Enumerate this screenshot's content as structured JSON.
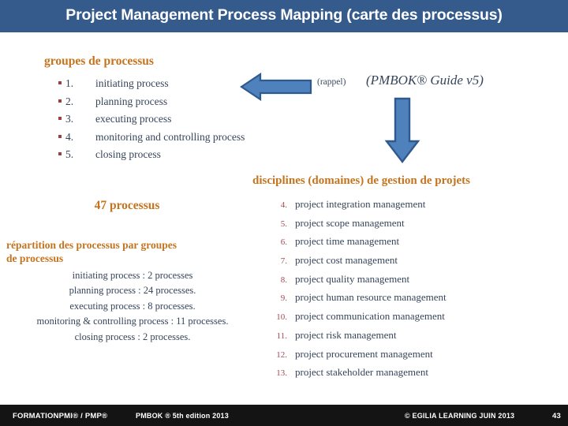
{
  "slide": {
    "title": "Project Management Process Mapping  (carte des processus)",
    "page_number": "43",
    "accent_color": "#c4741e",
    "banner_color": "#355b8c",
    "arrow_fill": "#4f81bd",
    "arrow_stroke": "#2e5a8e",
    "body_text_color": "#36455a",
    "number_color": "#a14a55",
    "footer_color": "#141414"
  },
  "process_groups": {
    "heading": "groupes de processus",
    "items": [
      {
        "num": "1.",
        "label": "initiating process"
      },
      {
        "num": "2.",
        "label": "planning process"
      },
      {
        "num": "3.",
        "label": "executing process"
      },
      {
        "num": "4.",
        "label": "monitoring and controlling process"
      },
      {
        "num": "5.",
        "label": "closing process"
      }
    ]
  },
  "annotation": {
    "rappel": "(rappel)",
    "pmbok_guide": "(PMBOK® Guide v5)",
    "left_arrow_icon": "arrow-left-icon",
    "down_arrow_icon": "arrow-down-icon"
  },
  "knowledge_areas": {
    "heading": "disciplines (domaines) de gestion de projets",
    "items": [
      {
        "num": "4.",
        "label": "project integration management"
      },
      {
        "num": "5.",
        "label": "project scope management"
      },
      {
        "num": "6.",
        "label": "project time management"
      },
      {
        "num": "7.",
        "label": "project cost management"
      },
      {
        "num": "8.",
        "label": "project quality management"
      },
      {
        "num": "9.",
        "label": "project human resource management"
      },
      {
        "num": "10.",
        "label": "project communication management"
      },
      {
        "num": "11.",
        "label": "project risk management"
      },
      {
        "num": "12.",
        "label": "project procurement management"
      },
      {
        "num": "13.",
        "label": "project stakeholder management"
      }
    ]
  },
  "distribution": {
    "count_label": "47 processus",
    "heading": "répartition des processus par groupes de processus",
    "rows": [
      "initiating process : 2 processes",
      "planning process  : 24 processes.",
      "executing process : 8 processes.",
      "monitoring & controlling process : 11 processes.",
      "closing process : 2 processes."
    ]
  },
  "footer": {
    "formation": "FORMATIONPMI® / PMP®",
    "pmbok_edition": "PMBOK ® 5th edition  2013",
    "copyright": "© EGILIA LEARNING  JUIN 2013",
    "page": "43"
  }
}
